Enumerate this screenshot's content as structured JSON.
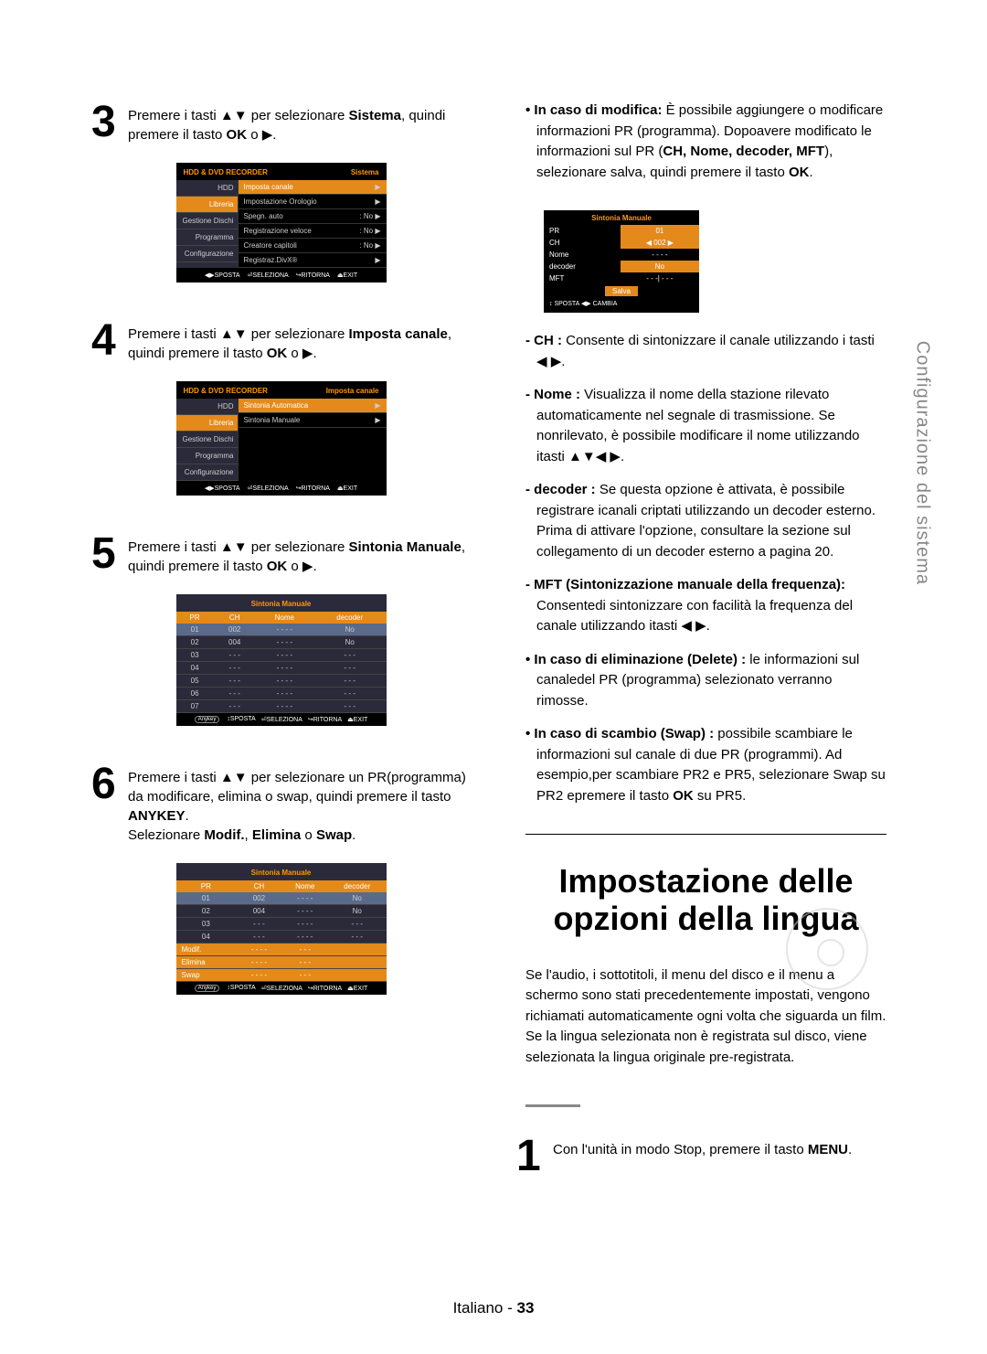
{
  "side_tab": "Configurazione del sistema",
  "left": {
    "step3": {
      "num": "3",
      "text_before": "Premere i tasti ▲▼ per selezionare ",
      "bold1": "Sistema",
      "text_mid": ", quindi premere il tasto ",
      "bold2": "OK",
      "text_after": " o ▶."
    },
    "osd3": {
      "title_left": "HDD & DVD RECORDER",
      "title_right": "Sistema",
      "side": [
        "HDD",
        "Libreria",
        "Gestione Dischi",
        "Programma",
        "Configurazione"
      ],
      "rows": [
        {
          "l": "Imposta canale",
          "r": "▶",
          "hl": true
        },
        {
          "l": "Impostazione Orologio",
          "r": "▶"
        },
        {
          "l": "Spegn. auto",
          "r": ": No    ▶"
        },
        {
          "l": "Registrazione veloce",
          "r": ": No    ▶"
        },
        {
          "l": "Creatore capitoli",
          "r": ": No    ▶"
        },
        {
          "l": "Registraz.DivX®",
          "r": "▶"
        }
      ],
      "foot": [
        "◀▶SPOSTA",
        "⏎SELEZIONA",
        "↪RITORNA",
        "⏏EXIT"
      ]
    },
    "step4": {
      "num": "4",
      "text_before": "Premere i tasti ▲▼ per selezionare ",
      "bold1": "Imposta canale",
      "text_mid": ", quindi premere il tasto ",
      "bold2": "OK",
      "text_after": " o ▶."
    },
    "osd4": {
      "title_left": "HDD & DVD RECORDER",
      "title_right": "Imposta canale",
      "side": [
        "HDD",
        "Libreria",
        "Gestione Dischi",
        "Programma",
        "Configurazione"
      ],
      "rows": [
        {
          "l": "Sintonia Automatica",
          "r": "▶",
          "hl": true
        },
        {
          "l": "Sintonia Manuale",
          "r": "▶"
        }
      ],
      "foot": [
        "◀▶SPOSTA",
        "⏎SELEZIONA",
        "↪RITORNA",
        "⏏EXIT"
      ]
    },
    "step5": {
      "num": "5",
      "text_before": "Premere i tasti ▲▼ per selezionare ",
      "bold1": "Sintonia Manuale",
      "text_mid": ", quindi premere il tasto ",
      "bold2": "OK",
      "text_after": " o ▶."
    },
    "osd5": {
      "title": "Sintonia Manuale",
      "headers": [
        "PR",
        "CH",
        "Nome",
        "decoder"
      ],
      "rows": [
        [
          "01",
          "002",
          "- - - -",
          "No"
        ],
        [
          "02",
          "004",
          "- - - -",
          "No"
        ],
        [
          "03",
          "- - -",
          "- - - -",
          "- - -"
        ],
        [
          "04",
          "- - -",
          "- - - -",
          "- - -"
        ],
        [
          "05",
          "- - -",
          "- - - -",
          "- - -"
        ],
        [
          "06",
          "- - -",
          "- - - -",
          "- - -"
        ],
        [
          "07",
          "- - -",
          "- - - -",
          "- - -"
        ]
      ],
      "foot": [
        "Anykey",
        "↕SPOSTA",
        "⏎SELEZIONA",
        "↪RITORNA",
        "⏏EXIT"
      ]
    },
    "step6": {
      "num": "6",
      "line1_before": "Premere i tasti ▲▼ per selezionare un PR(programma) da modificare, elimina o swap, quindi premere il tasto ",
      "bold1": "ANYKEY",
      "line1_after": ".",
      "line2_before": "Selezionare ",
      "bold2": "Modif.",
      "sep1": ", ",
      "bold3": "Elimina",
      "sep2": " o ",
      "bold4": "Swap",
      "line2_after": "."
    },
    "osd6": {
      "title": "Sintonia Manuale",
      "headers": [
        "PR",
        "CH",
        "Nome",
        "decoder"
      ],
      "rows": [
        [
          "01",
          "002",
          "- - - -",
          "No"
        ],
        [
          "02",
          "004",
          "- - - -",
          "No"
        ],
        [
          "03",
          "- - -",
          "- - - -",
          "- - -"
        ],
        [
          "04",
          "- - -",
          "- - - -",
          "- - -"
        ]
      ],
      "menu": [
        "Modif.",
        "Elimina",
        "Swap"
      ],
      "foot": [
        "Anykey",
        "↕SPOSTA",
        "⏎SELEZIONA",
        "↪RITORNA",
        "⏏EXIT"
      ]
    }
  },
  "right": {
    "top_bullet": {
      "lead": "• In caso di modifica:",
      "rest": " È possibile aggiungere o modificare informazioni PR (programma). Dopoavere modificato le informazioni sul PR (",
      "bold_list": "CH, Nome, decoder, MFT",
      "rest2": "), selezionare salva, quindi premere il tasto ",
      "bold_ok": "OK",
      "rest3": "."
    },
    "osd_small": {
      "title": "Sintonia Manuale",
      "rows": [
        [
          "PR",
          "01"
        ],
        [
          "CH",
          "◀ 002 ▶"
        ],
        [
          "Nome",
          "- - - -"
        ],
        [
          "decoder",
          "No"
        ],
        [
          "MFT",
          "- - -| - - -"
        ]
      ],
      "save": "Salva",
      "foot": "↕ SPOSTA   ◀▶ CAMBIA"
    },
    "defs": [
      {
        "lead": "- CH :",
        "rest": " Consente di sintonizzare il canale utilizzando i tasti ◀ ▶."
      },
      {
        "lead": "- Nome :",
        "rest": " Visualizza il nome della stazione rilevato automaticamente nel segnale di trasmissione. Se nonrilevato, è possibile modificare il nome utilizzando itasti ▲▼◀ ▶."
      },
      {
        "lead": "- decoder :",
        "rest": " Se questa opzione è attivata, è possibile registrare icanali criptati utilizzando un decoder esterno. Prima di attivare l'opzione, consultare la sezione sul collegamento di un decoder esterno a pagina 20."
      },
      {
        "lead": "- MFT (Sintonizzazione manuale della frequenza):",
        "rest": " Consentedi sintonizzare con facilità la frequenza del canale utilizzando itasti ◀ ▶."
      },
      {
        "lead": "• In caso di eliminazione (Delete) :",
        "rest": " le informazioni sul canaledel PR (programma) selezionato verranno rimosse."
      },
      {
        "lead": "• In caso di scambio (Swap) :",
        "rest": " possibile scambiare le informazioni sul canale di due PR (programmi). Ad esempio,per scambiare PR2 e PR5, selezionare Swap su PR2 epremere il tasto ",
        "bold": "OK",
        "rest2": " su PR5."
      }
    ],
    "big_title_l1": "Impostazione delle",
    "big_title_l2": "opzioni della lingua",
    "intro": "Se l'audio, i sottotitoli, il menu del disco e il menu a schermo sono stati precedentemente impostati, vengono richiamati automaticamente ogni volta che siguarda un film. Se la lingua selezionata non è registrata sul disco, viene selezionata la lingua originale pre-registrata.",
    "step1": {
      "num": "1",
      "text_before": "Con l'unità in modo Stop, premere il tasto ",
      "bold": "MENU",
      "text_after": "."
    }
  },
  "footer": {
    "lang": "Italiano",
    "sep": " - ",
    "page": "33"
  }
}
